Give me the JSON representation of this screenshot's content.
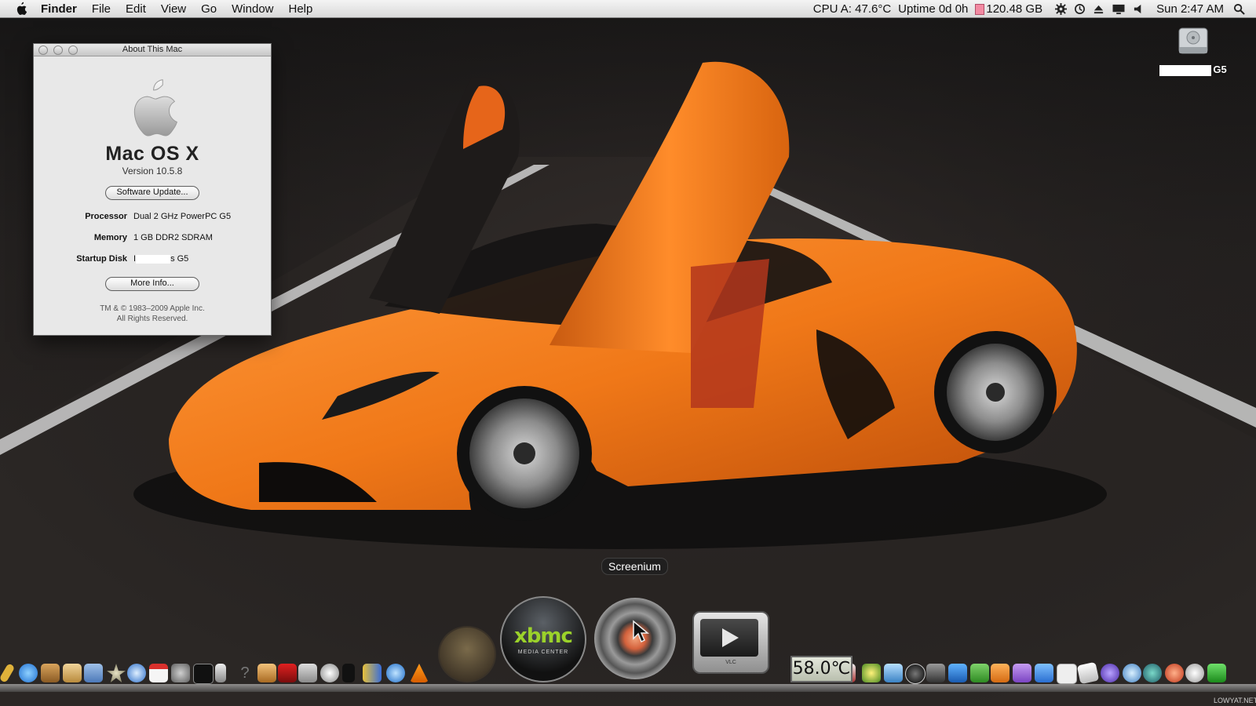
{
  "menubar": {
    "app_name": "Finder",
    "menus": [
      "File",
      "Edit",
      "View",
      "Go",
      "Window",
      "Help"
    ],
    "cpu_temp": "CPU A: 47.6°C",
    "uptime": "Uptime 0d 0h",
    "disk_free": "120.48 GB",
    "clock": "Sun 2:47 AM"
  },
  "about_window": {
    "title": "About This Mac",
    "os_name": "Mac OS X",
    "version": "Version 10.5.8",
    "software_update_label": "Software Update...",
    "processor_label": "Processor",
    "processor_value": "Dual 2 GHz PowerPC G5",
    "memory_label": "Memory",
    "memory_value": "1 GB DDR2 SDRAM",
    "startup_disk_label": "Startup Disk",
    "startup_disk_value_prefix": "I",
    "startup_disk_value_suffix": "s G5",
    "more_info_label": "More Info...",
    "copyright_line1": "TM & © 1983–2009 Apple Inc.",
    "copyright_line2": "All Rights Reserved."
  },
  "desktop": {
    "drive_label_suffix": "G5"
  },
  "dock": {
    "tooltip": "Screenium",
    "temperature_widget": "58.0℃",
    "xbmc_label": "xbmc",
    "xbmc_sub": "MEDIA CENTER",
    "vlc_label": "VLC"
  },
  "watermark": "LOWYAT.NET",
  "colors": {
    "car_orange": "#f07818",
    "road": "#2a2624",
    "menubar": "#e6e6e6"
  }
}
